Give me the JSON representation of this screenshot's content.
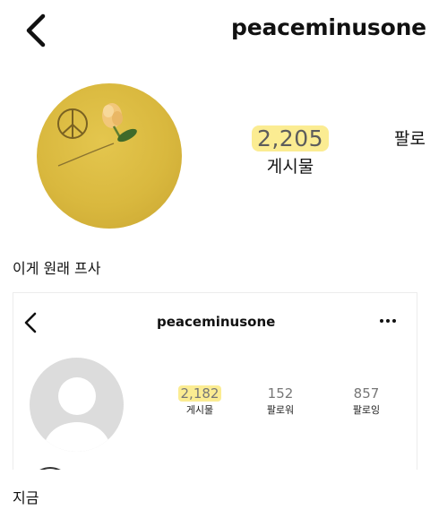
{
  "profile_main": {
    "username": "peaceminusone",
    "posts_count": "2,205",
    "posts_label": "게시물",
    "next_label_partial": "팔로"
  },
  "caption_original": "이게 원래 프사",
  "profile_current": {
    "username": "peaceminusone",
    "stats": [
      {
        "count": "2,182",
        "label": "게시물",
        "highlighted": true
      },
      {
        "count": "152",
        "label": "팔로워",
        "highlighted": false
      },
      {
        "count": "857",
        "label": "팔로잉",
        "highlighted": false
      }
    ]
  },
  "caption_now": "지금",
  "colors": {
    "highlight": "#fbec92",
    "avatar_yellow": "#d9b83e",
    "default_avatar_gray": "#dcdcdc"
  }
}
